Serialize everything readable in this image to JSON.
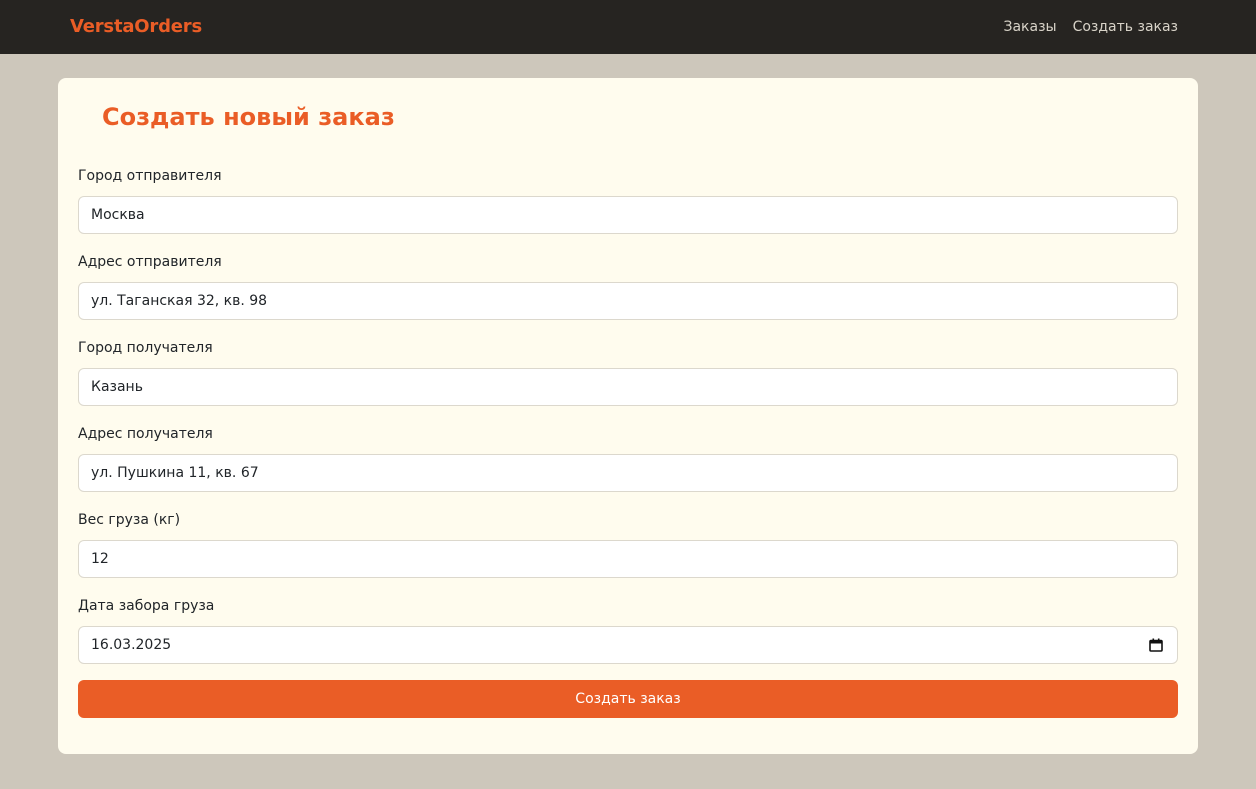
{
  "nav": {
    "brand": "VerstaOrders",
    "links": [
      {
        "label": "Заказы"
      },
      {
        "label": "Создать заказ"
      }
    ]
  },
  "form": {
    "title": "Создать новый заказ",
    "fields": [
      {
        "label": "Город отправителя",
        "value": "Москва"
      },
      {
        "label": "Адрес отправителя",
        "value": "ул. Таганская 32, кв. 98"
      },
      {
        "label": "Город получателя",
        "value": "Казань"
      },
      {
        "label": "Адрес получателя",
        "value": "ул. Пушкина 11, кв. 67"
      },
      {
        "label": "Вес груза (кг)",
        "value": "12"
      },
      {
        "label": "Дата забора груза",
        "value": "16.03.2025",
        "icon": "calendar-icon"
      }
    ],
    "submit_label": "Создать заказ"
  },
  "colors": {
    "accent": "#ea5d26",
    "navbar_bg": "#262421",
    "page_bg": "#cdc7bb",
    "card_bg": "#fffcee"
  }
}
